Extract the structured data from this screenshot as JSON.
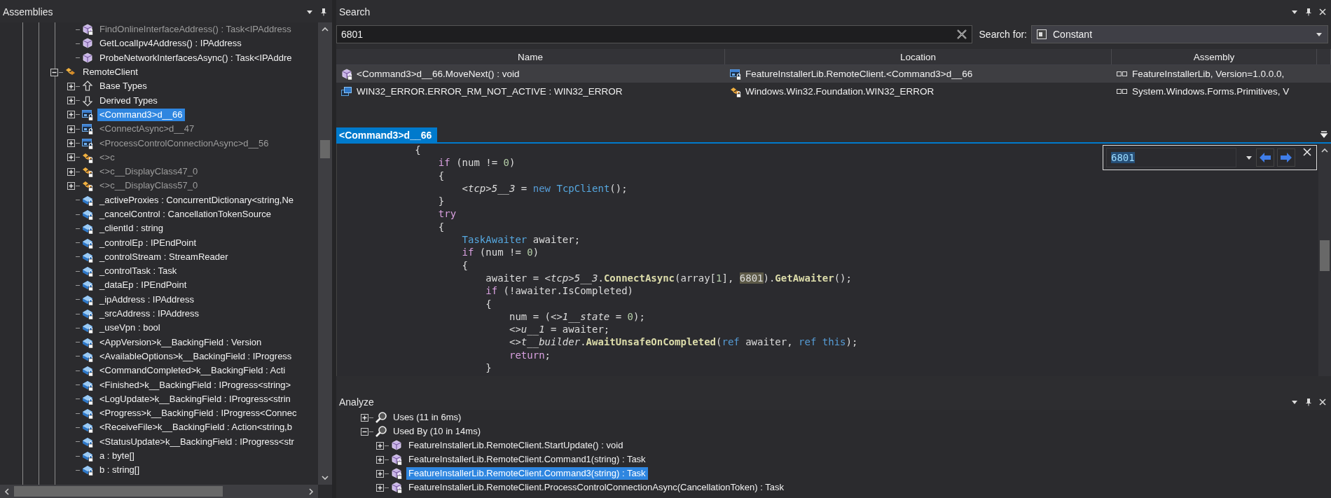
{
  "assemblies_panel": {
    "title": "Assemblies",
    "tree": [
      {
        "kind": "continuation",
        "children": [
          {
            "label": "FindOnlineInterfaceAddress() : Task<IPAddress",
            "kind": "method",
            "locked": true,
            "dimmed": true,
            "selected": false
          },
          {
            "label": "GetLocalIpv4Address() : IPAddress",
            "kind": "method",
            "locked": false,
            "dimmed": false,
            "selected": false
          },
          {
            "label": "ProbeNetworkInterfacesAsync() : Task<IPAddre",
            "kind": "method",
            "locked": false,
            "dimmed": false,
            "selected": false
          }
        ]
      },
      {
        "label": "RemoteClient",
        "kind": "class",
        "locked": false,
        "dimmed": false,
        "selected": false,
        "expanded": true,
        "children": [
          {
            "label": "Base Types",
            "kind": "base-types",
            "locked": false,
            "dimmed": false,
            "selected": false,
            "expanded": false
          },
          {
            "label": "Derived Types",
            "kind": "derived-types",
            "locked": false,
            "dimmed": false,
            "selected": false,
            "expanded": false
          },
          {
            "label": "<Command3>d__66",
            "kind": "state-machine",
            "locked": true,
            "dimmed": false,
            "selected": true,
            "expanded": false
          },
          {
            "label": "<ConnectAsync>d__47",
            "kind": "state-machine",
            "locked": true,
            "dimmed": true,
            "selected": false,
            "expanded": false
          },
          {
            "label": "<ProcessControlConnectionAsync>d__56",
            "kind": "state-machine",
            "locked": true,
            "dimmed": true,
            "selected": false,
            "expanded": false
          },
          {
            "label": "<>c",
            "kind": "class",
            "locked": true,
            "dimmed": true,
            "selected": false,
            "expanded": false
          },
          {
            "label": "<>c__DisplayClass47_0",
            "kind": "class",
            "locked": true,
            "dimmed": true,
            "selected": false,
            "expanded": false
          },
          {
            "label": "<>c__DisplayClass57_0",
            "kind": "class",
            "locked": true,
            "dimmed": true,
            "selected": false,
            "expanded": false
          },
          {
            "label": "_activeProxies : ConcurrentDictionary<string,Ne",
            "kind": "field",
            "locked": true,
            "dimmed": false,
            "selected": false
          },
          {
            "label": "_cancelControl : CancellationTokenSource",
            "kind": "field",
            "locked": true,
            "dimmed": false,
            "selected": false
          },
          {
            "label": "_clientId : string",
            "kind": "field",
            "locked": true,
            "dimmed": false,
            "selected": false
          },
          {
            "label": "_controlEp : IPEndPoint",
            "kind": "field",
            "locked": true,
            "dimmed": false,
            "selected": false
          },
          {
            "label": "_controlStream : StreamReader",
            "kind": "field",
            "locked": true,
            "dimmed": false,
            "selected": false
          },
          {
            "label": "_controlTask : Task",
            "kind": "field",
            "locked": true,
            "dimmed": false,
            "selected": false
          },
          {
            "label": "_dataEp : IPEndPoint",
            "kind": "field",
            "locked": true,
            "dimmed": false,
            "selected": false
          },
          {
            "label": "_ipAddress : IPAddress",
            "kind": "field",
            "locked": true,
            "dimmed": false,
            "selected": false
          },
          {
            "label": "_srcAddress : IPAddress",
            "kind": "field",
            "locked": true,
            "dimmed": false,
            "selected": false
          },
          {
            "label": "_useVpn : bool",
            "kind": "field",
            "locked": true,
            "dimmed": false,
            "selected": false
          },
          {
            "label": "<AppVersion>k__BackingField : Version",
            "kind": "field",
            "locked": true,
            "dimmed": false,
            "selected": false
          },
          {
            "label": "<AvailableOptions>k__BackingField : IProgress",
            "kind": "field",
            "locked": true,
            "dimmed": false,
            "selected": false
          },
          {
            "label": "<CommandCompleted>k__BackingField : Acti",
            "kind": "field",
            "locked": true,
            "dimmed": false,
            "selected": false
          },
          {
            "label": "<Finished>k__BackingField : IProgress<string>",
            "kind": "field",
            "locked": true,
            "dimmed": false,
            "selected": false
          },
          {
            "label": "<LogUpdate>k__BackingField : IProgress<strin",
            "kind": "field",
            "locked": true,
            "dimmed": false,
            "selected": false
          },
          {
            "label": "<Progress>k__BackingField : IProgress<Connec",
            "kind": "field",
            "locked": true,
            "dimmed": false,
            "selected": false
          },
          {
            "label": "<ReceiveFile>k__BackingField : Action<string,b",
            "kind": "field",
            "locked": true,
            "dimmed": false,
            "selected": false
          },
          {
            "label": "<StatusUpdate>k__BackingField : IProgress<str",
            "kind": "field",
            "locked": true,
            "dimmed": false,
            "selected": false
          },
          {
            "label": "a : byte[]",
            "kind": "field",
            "locked": true,
            "dimmed": false,
            "selected": false
          },
          {
            "label": "b : string[]",
            "kind": "field",
            "locked": true,
            "dimmed": false,
            "selected": false
          }
        ]
      }
    ]
  },
  "search_panel": {
    "title": "Search",
    "query": "6801",
    "search_for_label": "Search for:",
    "search_for": "Constant",
    "columns": [
      "Name",
      "Location",
      "Assembly"
    ],
    "results": [
      {
        "selected": true,
        "name": {
          "text": "<Command3>d__66.MoveNext() : void",
          "kind": "method",
          "locked": true
        },
        "location": {
          "text": "FeatureInstallerLib.RemoteClient.<Command3>d__66",
          "kind": "state-machine",
          "locked": true
        },
        "assembly": {
          "text": "FeatureInstallerLib, Version=1.0.0.0,",
          "kind": "assembly",
          "locked": false
        }
      },
      {
        "selected": false,
        "name": {
          "text": "WIN32_ERROR.ERROR_RM_NOT_ACTIVE : WIN32_ERROR",
          "kind": "enum-member",
          "locked": false
        },
        "location": {
          "text": "Windows.Win32.Foundation.WIN32_ERROR",
          "kind": "class",
          "locked": true
        },
        "assembly": {
          "text": "System.Windows.Forms.Primitives, V",
          "kind": "assembly",
          "locked": false
        }
      }
    ]
  },
  "editor": {
    "tabs": [
      {
        "label": "<Command3>d__66",
        "selected": true
      }
    ],
    "find": {
      "value": "6801"
    },
    "code_lines": [
      [
        {
          "text": "            {",
          "kind": "plain"
        }
      ],
      [
        {
          "text": "                if",
          "kind": "control"
        },
        {
          "text": " (num != ",
          "kind": "plain"
        },
        {
          "text": "0",
          "kind": "number"
        },
        {
          "text": ")",
          "kind": "plain"
        }
      ],
      [
        {
          "text": "                {",
          "kind": "plain"
        }
      ],
      [
        {
          "text": "                    <tcp>5__3",
          "kind": "field"
        },
        {
          "text": " = ",
          "kind": "plain"
        },
        {
          "text": "new",
          "kind": "keyword"
        },
        {
          "text": " TcpClient",
          "kind": "type"
        },
        {
          "text": "();",
          "kind": "plain"
        }
      ],
      [
        {
          "text": "                }",
          "kind": "plain"
        }
      ],
      [
        {
          "text": "                try",
          "kind": "control"
        }
      ],
      [
        {
          "text": "                {",
          "kind": "plain"
        }
      ],
      [
        {
          "text": "                    TaskAwaiter",
          "kind": "type"
        },
        {
          "text": " awaiter;",
          "kind": "plain"
        }
      ],
      [
        {
          "text": "                    if",
          "kind": "control"
        },
        {
          "text": " (num != ",
          "kind": "plain"
        },
        {
          "text": "0",
          "kind": "number"
        },
        {
          "text": ")",
          "kind": "plain"
        }
      ],
      [
        {
          "text": "                    {",
          "kind": "plain"
        }
      ],
      [
        {
          "text": "                        awaiter = ",
          "kind": "plain"
        },
        {
          "text": "<tcp>5__3",
          "kind": "field"
        },
        {
          "text": ".",
          "kind": "plain"
        },
        {
          "text": "ConnectAsync",
          "kind": "method"
        },
        {
          "text": "(array[",
          "kind": "plain"
        },
        {
          "text": "1",
          "kind": "number"
        },
        {
          "text": "], ",
          "kind": "plain"
        },
        {
          "text": "6801",
          "kind": "match"
        },
        {
          "text": ").",
          "kind": "plain"
        },
        {
          "text": "GetAwaiter",
          "kind": "method"
        },
        {
          "text": "();",
          "kind": "plain"
        }
      ],
      [
        {
          "text": "                        if",
          "kind": "control"
        },
        {
          "text": " (!awaiter.IsCompleted)",
          "kind": "plain"
        }
      ],
      [
        {
          "text": "                        {",
          "kind": "plain"
        }
      ],
      [
        {
          "text": "                            num = (",
          "kind": "plain"
        },
        {
          "text": "<>1__state",
          "kind": "field"
        },
        {
          "text": " = ",
          "kind": "plain"
        },
        {
          "text": "0",
          "kind": "number"
        },
        {
          "text": ");",
          "kind": "plain"
        }
      ],
      [
        {
          "text": "                            <>u__1",
          "kind": "field"
        },
        {
          "text": " = awaiter;",
          "kind": "plain"
        }
      ],
      [
        {
          "text": "                            <>t__builder",
          "kind": "field"
        },
        {
          "text": ".",
          "kind": "plain"
        },
        {
          "text": "AwaitUnsafeOnCompleted",
          "kind": "method"
        },
        {
          "text": "(",
          "kind": "plain"
        },
        {
          "text": "ref",
          "kind": "keyword"
        },
        {
          "text": " awaiter, ",
          "kind": "plain"
        },
        {
          "text": "ref this",
          "kind": "keyword"
        },
        {
          "text": ");",
          "kind": "plain"
        }
      ],
      [
        {
          "text": "                            return",
          "kind": "control"
        },
        {
          "text": ";",
          "kind": "plain"
        }
      ],
      [
        {
          "text": "                        }",
          "kind": "plain"
        }
      ]
    ]
  },
  "analyze_panel": {
    "title": "Analyze",
    "tree": [
      {
        "label": "Uses (11 in 6ms)",
        "kind": "analyzer",
        "locked": false,
        "selected": false,
        "expanded": false
      },
      {
        "label": "Used By (10 in 14ms)",
        "kind": "analyzer",
        "locked": false,
        "selected": false,
        "expanded": true,
        "children": [
          {
            "label": "FeatureInstallerLib.RemoteClient.StartUpdate() : void",
            "kind": "method",
            "locked": false,
            "selected": false,
            "expanded": false
          },
          {
            "label": "FeatureInstallerLib.RemoteClient.Command1(string) : Task",
            "kind": "method",
            "locked": true,
            "selected": false,
            "expanded": false
          },
          {
            "label": "FeatureInstallerLib.RemoteClient.Command3(string) : Task",
            "kind": "method",
            "locked": true,
            "selected": true,
            "expanded": false
          },
          {
            "label": "FeatureInstallerLib.RemoteClient.ProcessControlConnectionAsync(CancellationToken) : Task",
            "kind": "method",
            "locked": true,
            "selected": false,
            "expanded": false
          }
        ]
      }
    ]
  }
}
